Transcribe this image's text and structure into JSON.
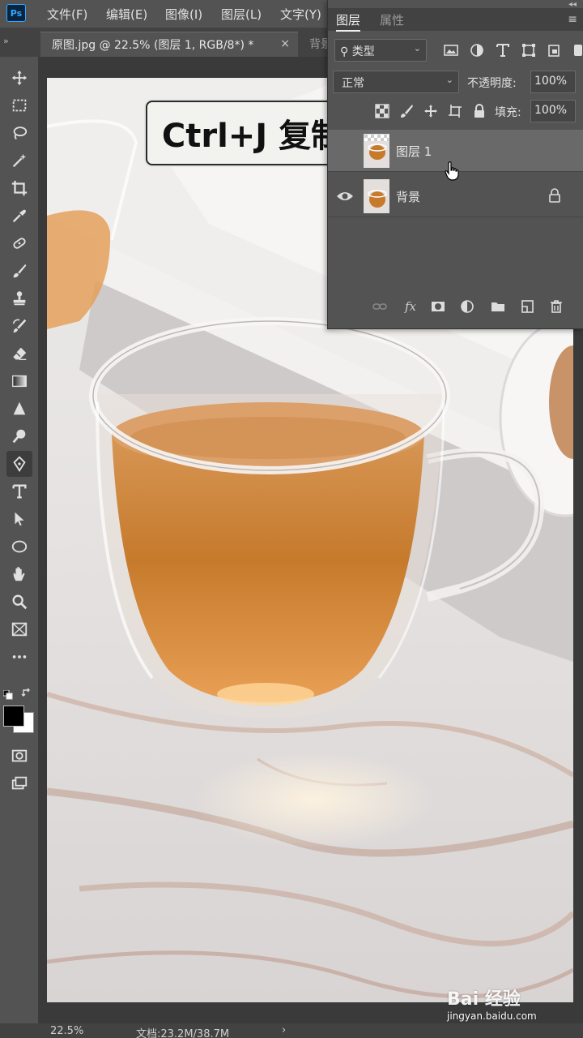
{
  "app": {
    "logo": "Ps"
  },
  "menu": [
    "文件(F)",
    "编辑(E)",
    "图像(I)",
    "图层(L)",
    "文字(Y)"
  ],
  "tabs": {
    "active": "原图.jpg @ 22.5% (图层 1, RGB/8*) *",
    "close": "×",
    "inactive": "背景"
  },
  "tools": [
    "move-icon",
    "marquee-icon",
    "lasso-icon",
    "magic-wand-icon",
    "crop-icon",
    "eyedropper-icon",
    "healing-brush-icon",
    "brush-icon",
    "clone-stamp-icon",
    "history-brush-icon",
    "eraser-icon",
    "gradient-icon",
    "blur-icon",
    "dodge-icon",
    "pen-icon",
    "type-icon",
    "path-select-icon",
    "ellipse-icon",
    "hand-icon",
    "zoom-icon",
    "frame-icon",
    "more-tools-icon"
  ],
  "caption": "Ctrl+J 复制",
  "layers_panel": {
    "tab_layers": "图层",
    "tab_properties": "属性",
    "filter_kind": "类型",
    "blend_mode": "正常",
    "opacity_label": "不透明度:",
    "opacity_value": "100%",
    "fill_label": "填充:",
    "fill_value": "100%",
    "layers": [
      {
        "name": "图层 1",
        "selected": true,
        "visible": false,
        "locked": false
      },
      {
        "name": "背景",
        "selected": false,
        "visible": true,
        "locked": true
      }
    ]
  },
  "status": {
    "zoom": "22.5%",
    "doc_size": "文档:23.2M/38.7M",
    "arrow": "›"
  },
  "watermark": {
    "logo": "Bai 经验",
    "url": "jingyan.baidu.com"
  },
  "colors": {
    "accent": "#31a8ff",
    "panel_bg": "#535353",
    "tea": "#c67a2c"
  }
}
